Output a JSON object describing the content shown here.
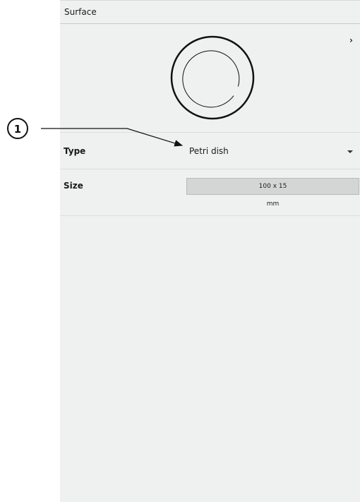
{
  "panel": {
    "title": "Surface",
    "expand_icon": "chevron-right-icon"
  },
  "preview": {
    "icon": "petri-dish-icon"
  },
  "type_row": {
    "label": "Type",
    "value": "Petri dish",
    "dropdown_icon": "caret-down-icon"
  },
  "size_row": {
    "label": "Size",
    "value": "100 x 15",
    "unit": "mm"
  },
  "callout": {
    "number": "1"
  }
}
